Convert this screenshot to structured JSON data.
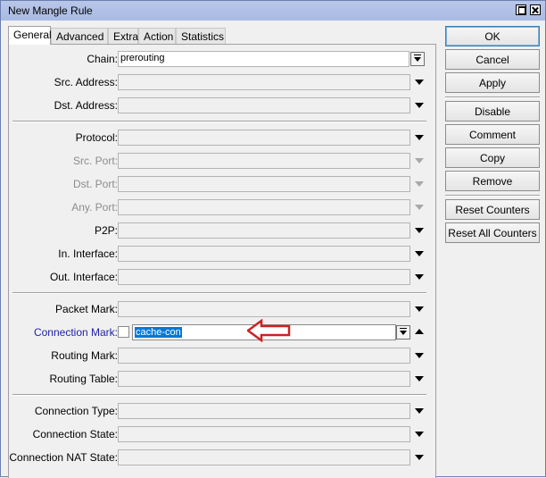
{
  "window": {
    "title": "New Mangle Rule"
  },
  "tabs": [
    "General",
    "Advanced",
    "Extra",
    "Action",
    "Statistics"
  ],
  "general": {
    "chain": {
      "label": "Chain:",
      "value": "prerouting"
    },
    "src_address": {
      "label": "Src. Address:"
    },
    "dst_address": {
      "label": "Dst. Address:"
    },
    "protocol": {
      "label": "Protocol:"
    },
    "src_port": {
      "label": "Src. Port:"
    },
    "dst_port": {
      "label": "Dst. Port:"
    },
    "any_port": {
      "label": "Any. Port:"
    },
    "p2p": {
      "label": "P2P:"
    },
    "in_interface": {
      "label": "In. Interface:"
    },
    "out_interface": {
      "label": "Out. Interface:"
    },
    "packet_mark": {
      "label": "Packet Mark:"
    },
    "connection_mark": {
      "label": "Connection Mark:",
      "value": "cache-con",
      "negate_checked": false
    },
    "routing_mark": {
      "label": "Routing Mark:"
    },
    "routing_table": {
      "label": "Routing Table:"
    },
    "connection_type": {
      "label": "Connection Type:"
    },
    "connection_state": {
      "label": "Connection State:"
    },
    "connection_nat_state": {
      "label": "Connection NAT State:"
    }
  },
  "buttons": {
    "ok": "OK",
    "cancel": "Cancel",
    "apply": "Apply",
    "disable": "Disable",
    "comment": "Comment",
    "copy": "Copy",
    "remove": "Remove",
    "reset_counters": "Reset Counters",
    "reset_all_counters": "Reset All Counters"
  },
  "colors": {
    "connection_mark_label": "#2222aa",
    "selection": "#0078d7",
    "annotation_arrow": "#cc2222"
  },
  "icons": [
    "maximize-icon",
    "close-icon",
    "dropdown-arrow-icon",
    "collapse-arrow-icon",
    "annotation-arrow-icon"
  ]
}
